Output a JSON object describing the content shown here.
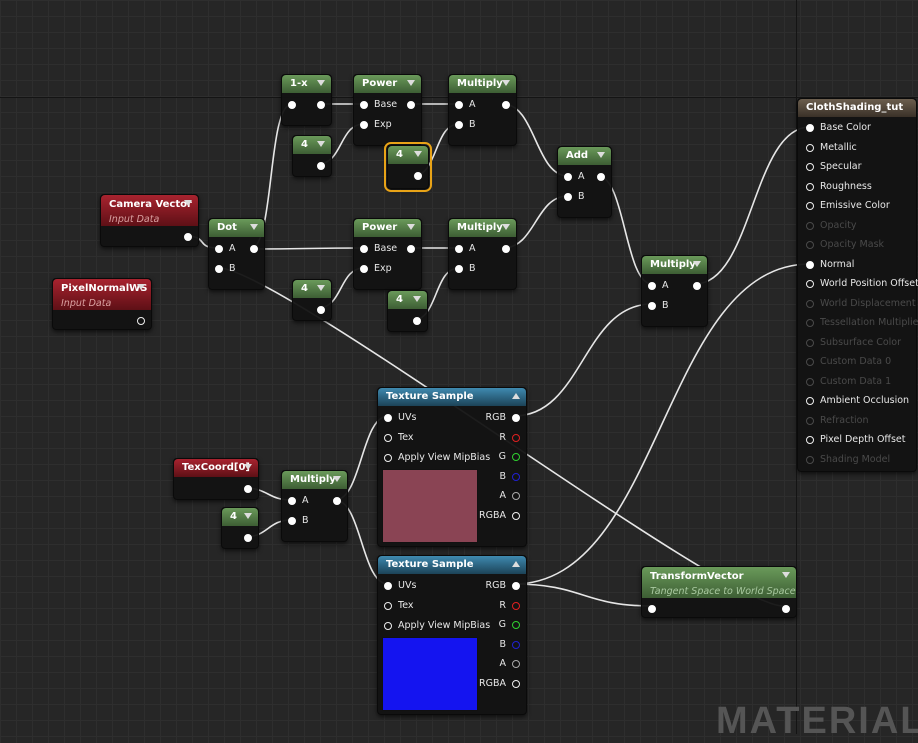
{
  "watermark": "MATERIAL",
  "colors": {
    "selection": "#e8a317",
    "preview1": "#8a4454",
    "preview2": "#1414f0"
  },
  "nodes": {
    "oneminus": {
      "title": "1-x"
    },
    "power1": {
      "title": "Power",
      "inputs": [
        "Base",
        "Exp"
      ]
    },
    "mult1": {
      "title": "Multiply",
      "inputs": [
        "A",
        "B"
      ]
    },
    "const1": {
      "title": "4"
    },
    "const2": {
      "title": "4"
    },
    "add": {
      "title": "Add",
      "inputs": [
        "A",
        "B"
      ]
    },
    "camera": {
      "title": "Camera Vector",
      "subtitle": "Input Data"
    },
    "dot": {
      "title": "Dot",
      "inputs": [
        "A",
        "B"
      ]
    },
    "power2": {
      "title": "Power",
      "inputs": [
        "Base",
        "Exp"
      ]
    },
    "mult2": {
      "title": "Multiply",
      "inputs": [
        "A",
        "B"
      ]
    },
    "const3": {
      "title": "4"
    },
    "const4": {
      "title": "4"
    },
    "mult3": {
      "title": "Multiply",
      "inputs": [
        "A",
        "B"
      ]
    },
    "pixelnormal": {
      "title": "PixelNormalWS",
      "subtitle": "Input Data"
    },
    "tex1": {
      "title": "Texture Sample",
      "inputs": [
        "UVs",
        "Tex",
        "Apply View MipBias"
      ],
      "outputs": [
        "RGB",
        "R",
        "G",
        "B",
        "A",
        "RGBA"
      ]
    },
    "tex2": {
      "title": "Texture Sample",
      "inputs": [
        "UVs",
        "Tex",
        "Apply View MipBias"
      ],
      "outputs": [
        "RGB",
        "R",
        "G",
        "B",
        "A",
        "RGBA"
      ]
    },
    "texcoord": {
      "title": "TexCoord[0]"
    },
    "mult4": {
      "title": "Multiply",
      "inputs": [
        "A",
        "B"
      ]
    },
    "const5": {
      "title": "4"
    },
    "transform": {
      "title": "TransformVector",
      "subtitle": "Tangent Space to World Space"
    }
  },
  "material": {
    "title": "ClothShading_tut",
    "pins": [
      {
        "label": "Base Color",
        "enabled": true,
        "connected": true
      },
      {
        "label": "Metallic",
        "enabled": true
      },
      {
        "label": "Specular",
        "enabled": true
      },
      {
        "label": "Roughness",
        "enabled": true
      },
      {
        "label": "Emissive Color",
        "enabled": true
      },
      {
        "label": "Opacity",
        "enabled": false
      },
      {
        "label": "Opacity Mask",
        "enabled": false
      },
      {
        "label": "Normal",
        "enabled": true,
        "connected": true
      },
      {
        "label": "World Position Offset",
        "enabled": true
      },
      {
        "label": "World Displacement",
        "enabled": false
      },
      {
        "label": "Tessellation Multiplier",
        "enabled": false
      },
      {
        "label": "Subsurface Color",
        "enabled": false
      },
      {
        "label": "Custom Data 0",
        "enabled": false
      },
      {
        "label": "Custom Data 1",
        "enabled": false
      },
      {
        "label": "Ambient Occlusion",
        "enabled": true
      },
      {
        "label": "Refraction",
        "enabled": false
      },
      {
        "label": "Pixel Depth Offset",
        "enabled": true
      },
      {
        "label": "Shading Model",
        "enabled": false
      }
    ]
  }
}
